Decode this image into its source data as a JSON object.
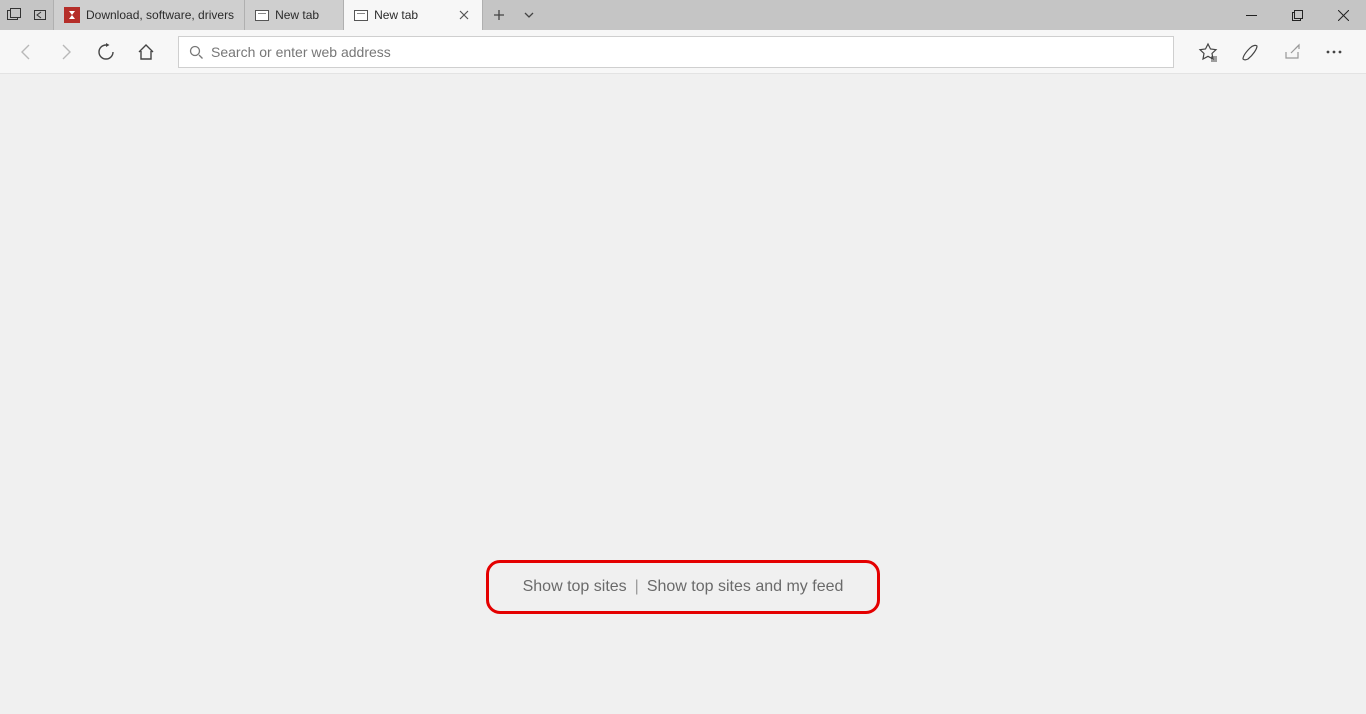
{
  "tabs": [
    {
      "label": "Download, software, drivers"
    },
    {
      "label": "New tab"
    },
    {
      "label": "New tab"
    }
  ],
  "address": {
    "placeholder": "Search or enter web address"
  },
  "newtab": {
    "show_top_sites": "Show top sites",
    "separator": "|",
    "show_top_sites_feed": "Show top sites and my feed"
  }
}
